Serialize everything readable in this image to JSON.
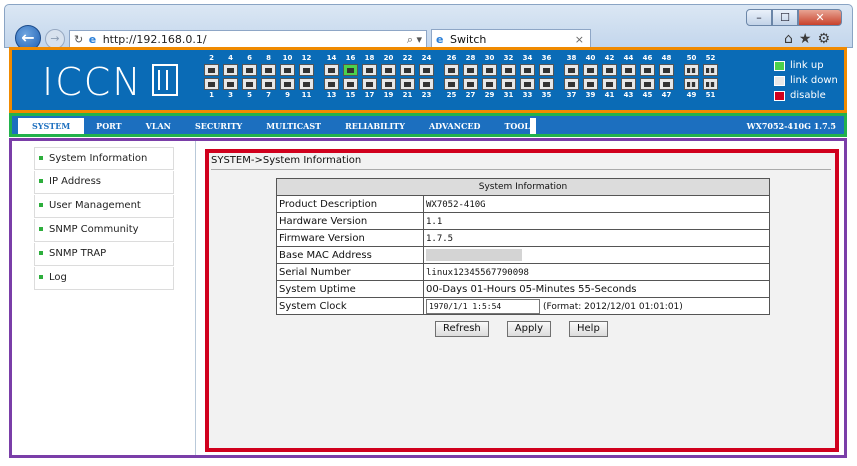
{
  "browser": {
    "url": "http://192.168.0.1/",
    "tab_title": "Switch",
    "tab_close": "×",
    "back": "←",
    "forward": "→",
    "reload": "↻",
    "search": "⌕ ▾",
    "min": "–",
    "max": "☐",
    "close": "✕",
    "icons": "⌂★⚙"
  },
  "header": {
    "logo": "ICCN",
    "ports_top": [
      [
        "2",
        "4",
        "6",
        "8",
        "10",
        "12"
      ],
      [
        "14",
        "16",
        "18",
        "20",
        "22",
        "24"
      ],
      [
        "26",
        "28",
        "30",
        "32",
        "34",
        "36"
      ],
      [
        "38",
        "40",
        "42",
        "44",
        "46",
        "48"
      ],
      [
        "50",
        "52"
      ]
    ],
    "ports_bottom": [
      [
        "1",
        "3",
        "5",
        "7",
        "9",
        "11"
      ],
      [
        "13",
        "15",
        "17",
        "19",
        "21",
        "23"
      ],
      [
        "25",
        "27",
        "29",
        "31",
        "33",
        "35"
      ],
      [
        "37",
        "39",
        "41",
        "43",
        "45",
        "47"
      ],
      [
        "49",
        "51"
      ]
    ],
    "ports_up": [
      "16"
    ],
    "legend": [
      {
        "label": "link up",
        "color": "#4cd24c"
      },
      {
        "label": "link down",
        "color": "#e8e8e8"
      },
      {
        "label": "disable",
        "color": "#d0001d"
      }
    ]
  },
  "menu": {
    "items": [
      "SYSTEM",
      "PORT",
      "VLAN",
      "SECURITY",
      "MULTICAST",
      "RELIABILITY",
      "ADVANCED",
      "TOOLS"
    ],
    "active": "SYSTEM",
    "model": "WX7052-410G 1.7.5"
  },
  "sidebar": {
    "items": [
      "System Information",
      "IP Address",
      "User Management",
      "SNMP Community",
      "SNMP TRAP",
      "Log"
    ]
  },
  "main": {
    "breadcrumb": "SYSTEM->System Information",
    "table_title": "System Information",
    "rows": [
      {
        "label": "Product Description",
        "value": "WX7052-410G"
      },
      {
        "label": "Hardware Version",
        "value": "1.1"
      },
      {
        "label": "Firmware Version",
        "value": "1.7.5"
      },
      {
        "label": "Base MAC Address",
        "value": ""
      },
      {
        "label": "Serial Number",
        "value": "linux12345567790098"
      },
      {
        "label": "System Uptime",
        "value": "00-Days 01-Hours 05-Minutes 55-Seconds"
      },
      {
        "label": "System Clock",
        "value": ""
      }
    ],
    "clock_value": "1970/1/1 1:5:54",
    "clock_format": "(Format: 2012/12/01 01:01:01)",
    "buttons": [
      "Refresh",
      "Apply",
      "Help"
    ]
  }
}
